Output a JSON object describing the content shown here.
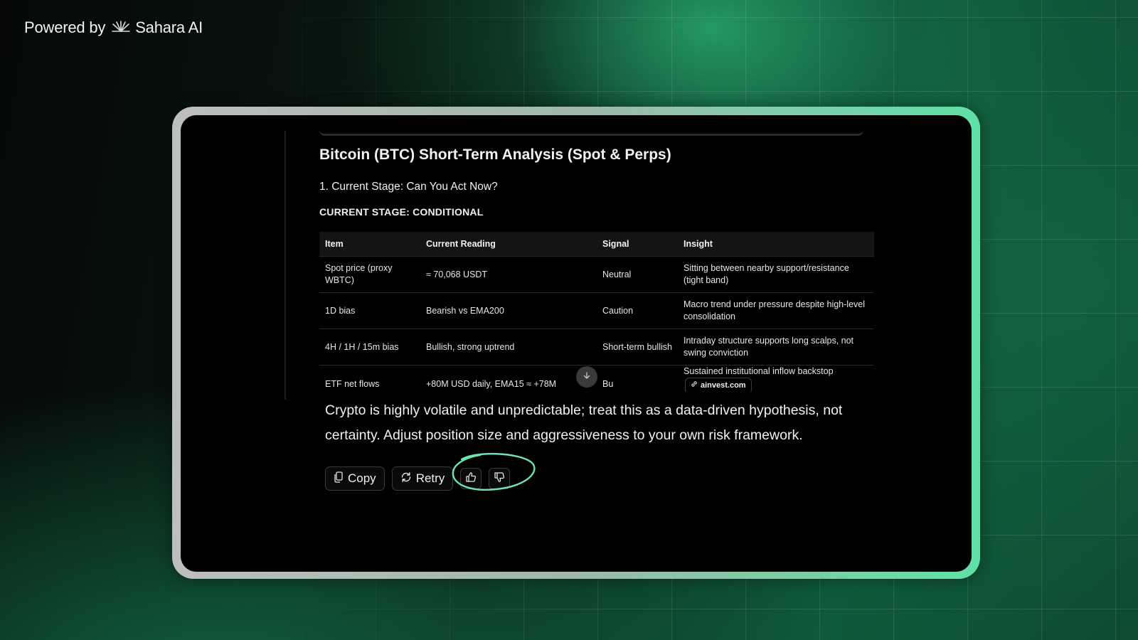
{
  "brand": {
    "powered_by": "Powered by",
    "name": "Sahara AI"
  },
  "colors": {
    "accent": "#5fe0a6",
    "frame_left": "#bdbfbd",
    "panel_bg": "#000000"
  },
  "report": {
    "title": "Bitcoin (BTC) Short-Term Analysis (Spot & Perps)",
    "section": "1. Current Stage: Can You Act Now?",
    "stage": "CURRENT STAGE: CONDITIONAL"
  },
  "table": {
    "headers": [
      "Item",
      "Current Reading",
      "Signal",
      "Insight"
    ],
    "rows": [
      {
        "item": "Spot price (proxy WBTC)",
        "reading": "≈ 70,068 USDT",
        "signal": "Neutral",
        "insight": "Sitting between nearby support/resistance (tight band)"
      },
      {
        "item": "1D bias",
        "reading": "Bearish vs EMA200",
        "signal": "Caution",
        "insight": "Macro trend under pressure despite high-level consolidation"
      },
      {
        "item": "4H / 1H / 15m bias",
        "reading": "Bullish, strong uptrend",
        "signal": "Short-term bullish",
        "insight": "Intraday structure supports long scalps, not swing conviction"
      },
      {
        "item": "ETF net flows",
        "reading": "+80M USD daily, EMA15 ≈ +78M",
        "signal": "Bu",
        "insight": "Sustained institutional inflow backstop",
        "source": "ainvest.com"
      }
    ]
  },
  "disclaimer": "Crypto is highly volatile and unpredictable; treat this as a data-driven hypothesis, not certainty. Adjust position size and aggressiveness to your own risk framework.",
  "actions": {
    "copy": "Copy",
    "retry": "Retry"
  },
  "icons": [
    "sahara-logo-icon",
    "copy-icon",
    "retry-icon",
    "thumbs-up-icon",
    "thumbs-down-icon",
    "link-icon",
    "arrow-down-icon"
  ]
}
